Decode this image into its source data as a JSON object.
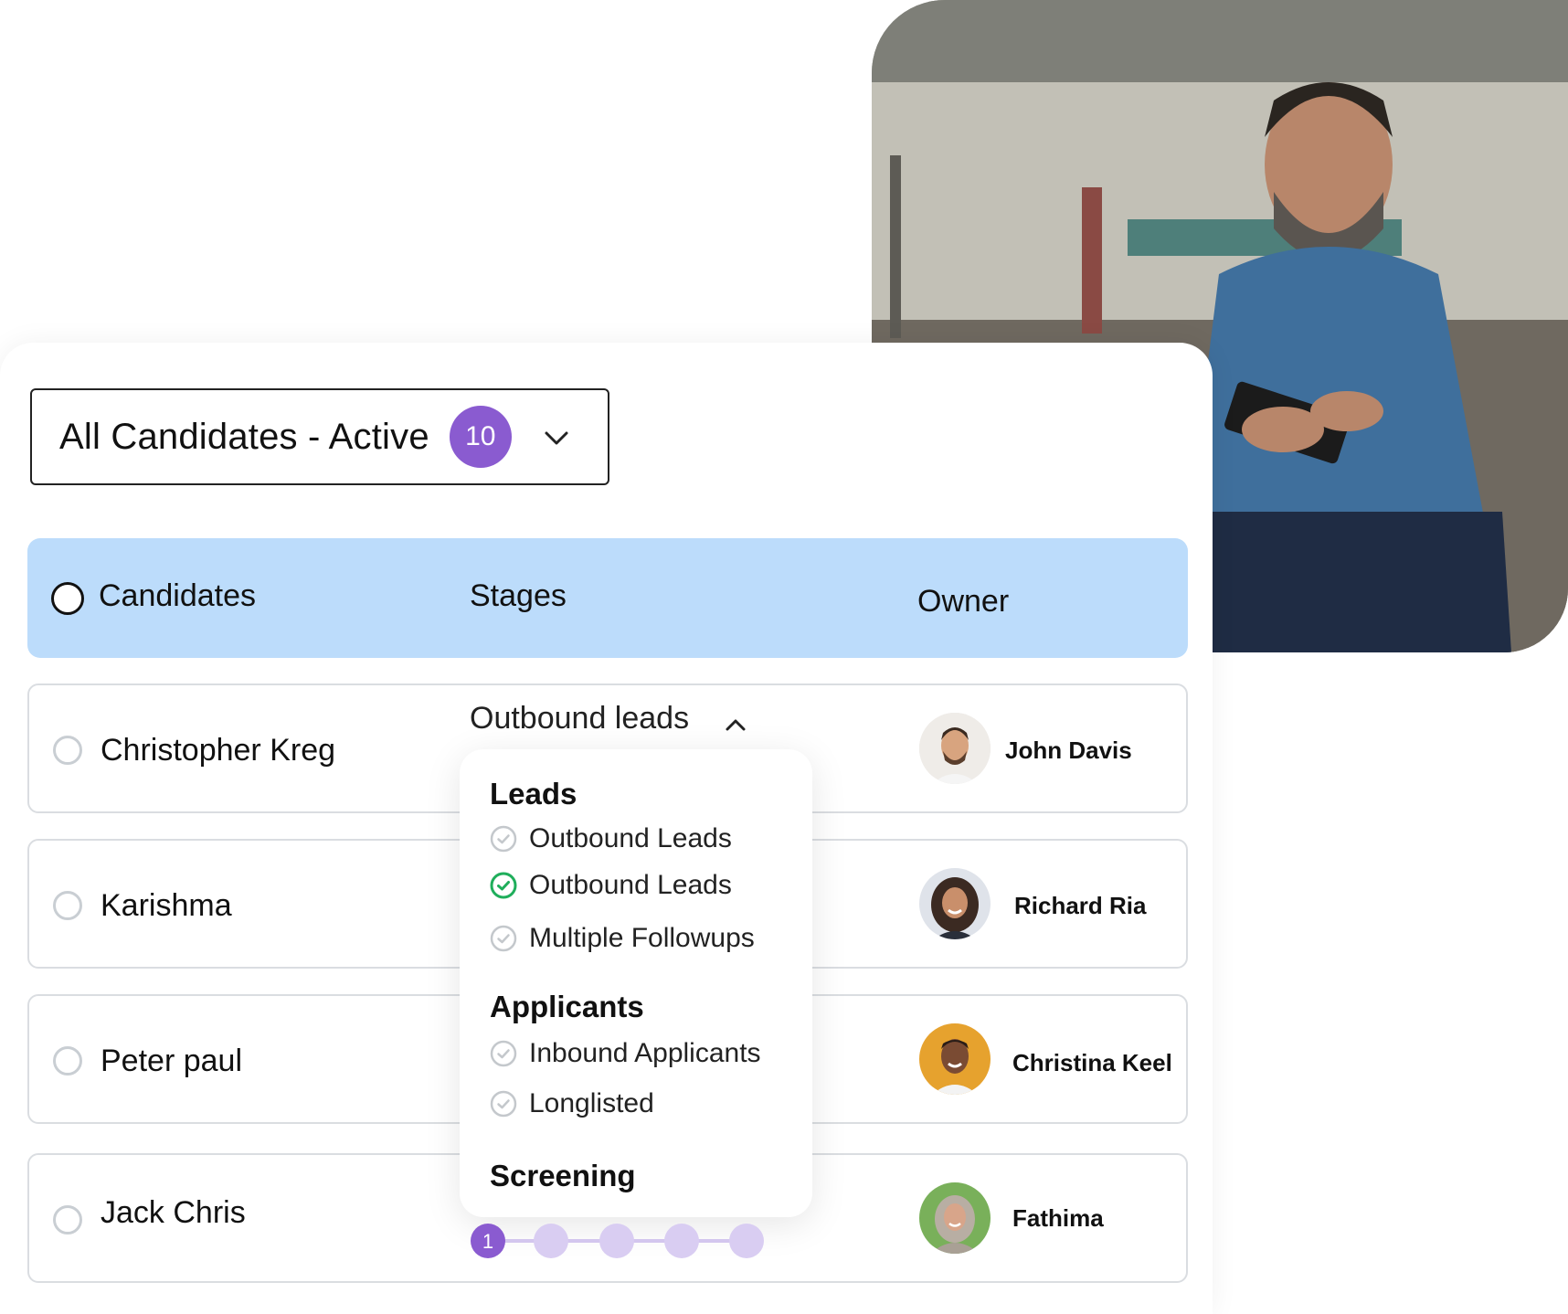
{
  "filter": {
    "label": "All Candidates - Active",
    "count": "10"
  },
  "table": {
    "headers": {
      "candidates": "Candidates",
      "stages": "Stages",
      "owner": "Owner"
    },
    "rows": [
      {
        "name": "Christopher Kreg",
        "owner": "John Davis"
      },
      {
        "name": "Karishma",
        "owner": "Richard Ria"
      },
      {
        "name": "Peter paul",
        "owner": "Christina Keel"
      },
      {
        "name": "Jack Chris",
        "owner": "Fathima"
      }
    ]
  },
  "stage_dropdown": {
    "current": "Outbound leads",
    "groups": [
      {
        "title": "Leads",
        "options": [
          "Outbound Leads",
          "Outbound Leads",
          "Multiple Followups"
        ]
      },
      {
        "title": "Applicants",
        "options": [
          "Inbound Applicants",
          "Longlisted"
        ]
      },
      {
        "title": "Screening",
        "options": []
      }
    ],
    "selected_option": "Outbound Leads (2nd)"
  },
  "stepper": {
    "current_step": "1",
    "total_steps": 5
  },
  "colors": {
    "accent": "#8a5bd0",
    "header_bg": "#bcdcfb",
    "check_green": "#1fae5b"
  }
}
